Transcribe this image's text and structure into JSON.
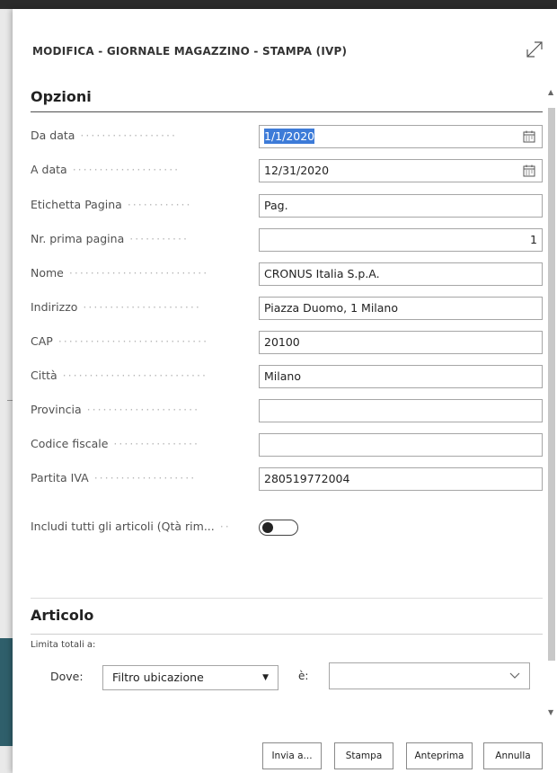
{
  "dialog": {
    "title": "MODIFICA - GIORNALE MAGAZZINO - STAMPA (IVP)"
  },
  "options": {
    "heading": "Opzioni",
    "fields": [
      {
        "label": "Da data",
        "value": "1/1/2020",
        "icon": "calendar-icon",
        "selected": true
      },
      {
        "label": "A data",
        "value": "12/31/2020",
        "icon": "calendar-icon"
      },
      {
        "label": "Etichetta Pagina",
        "value": "Pag."
      },
      {
        "label": "Nr. prima pagina",
        "value": "1"
      },
      {
        "label": "Nome",
        "value": "CRONUS Italia S.p.A."
      },
      {
        "label": "Indirizzo",
        "value": "Piazza Duomo, 1 Milano"
      },
      {
        "label": "CAP",
        "value": "20100"
      },
      {
        "label": "Città",
        "value": "Milano"
      },
      {
        "label": "Provincia",
        "value": ""
      },
      {
        "label": "Codice fiscale",
        "value": ""
      },
      {
        "label": "Partita IVA",
        "value": "280519772004"
      }
    ],
    "toggle": {
      "label": "Includi tutti gli articoli (Qtà rim...",
      "state": "off"
    }
  },
  "articolo": {
    "heading": "Articolo",
    "limit_label": "Limita totali a:",
    "where_label": "Dove:",
    "filter_field": "Filtro ubicazione",
    "is_label": "è:",
    "filter_value": ""
  },
  "buttons": {
    "send": "Invia a...",
    "print": "Stampa",
    "preview": "Anteprima",
    "cancel": "Annulla"
  },
  "colors": {
    "selection": "#3d7bd8",
    "side_accent": "#2f5f6b"
  }
}
